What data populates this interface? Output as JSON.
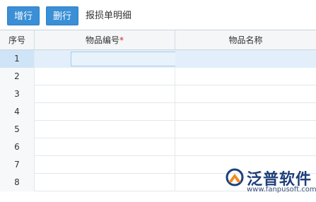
{
  "toolbar": {
    "add_row_label": "增行",
    "delete_row_label": "删行",
    "title": "报损单明细"
  },
  "table": {
    "columns": {
      "seq": "序号",
      "code": "物品编号",
      "code_required_mark": "*",
      "name": "物品名称"
    },
    "rows": [
      {
        "seq": "1",
        "code": "",
        "name": ""
      },
      {
        "seq": "2",
        "code": "",
        "name": ""
      },
      {
        "seq": "3",
        "code": "",
        "name": ""
      },
      {
        "seq": "4",
        "code": "",
        "name": ""
      },
      {
        "seq": "5",
        "code": "",
        "name": ""
      },
      {
        "seq": "6",
        "code": "",
        "name": ""
      },
      {
        "seq": "7",
        "code": "",
        "name": ""
      },
      {
        "seq": "8",
        "code": "",
        "name": ""
      }
    ]
  },
  "watermark": {
    "brand": "泛普软件",
    "url": "www.fanpusoft.com"
  },
  "colors": {
    "button": "#3a8fd6",
    "selected_row": "#e2effa",
    "required": "#e02020",
    "logo_blue": "#1e3f7a",
    "logo_orange": "#f08a1c"
  }
}
